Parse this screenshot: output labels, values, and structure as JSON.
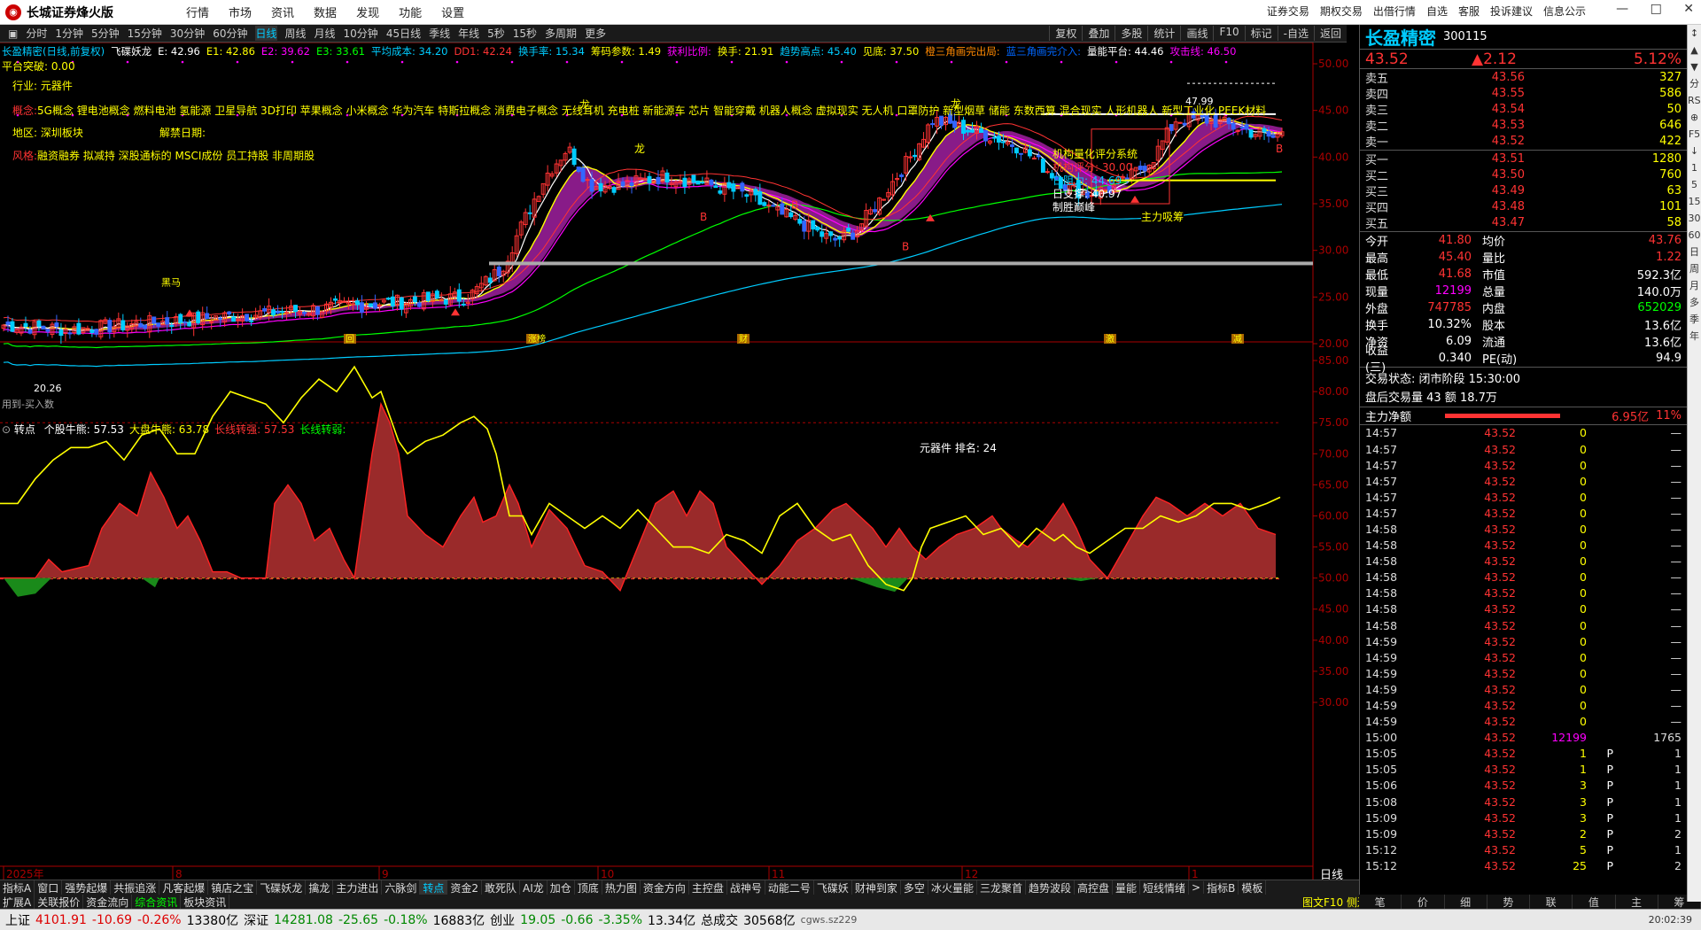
{
  "app": {
    "title": "长城证券烽火版",
    "menu": [
      "行情",
      "市场",
      "资讯",
      "数据",
      "发现",
      "功能",
      "设置"
    ],
    "right_menu": [
      "证券交易",
      "期权交易",
      "出借行情",
      "自选",
      "客服",
      "投诉建议",
      "信息公示"
    ],
    "win_icons": [
      "minimize-icon",
      "maximize-icon",
      "close-icon"
    ]
  },
  "periods": [
    "分时",
    "1分钟",
    "5分钟",
    "15分钟",
    "30分钟",
    "60分钟",
    "日线",
    "周线",
    "月线",
    "10分钟",
    "45日线",
    "季线",
    "年线",
    "5秒",
    "15秒",
    "多周期",
    "更多"
  ],
  "active_period": "日线",
  "toolbar_right": [
    "复权",
    "叠加",
    "多股",
    "统计",
    "画线",
    "F10",
    "标记",
    "-自选",
    "返回"
  ],
  "main_panel": {
    "header_items": [
      {
        "t": "长盈精密(日线,前复权)",
        "c": "#0cf"
      },
      {
        "t": "飞碟妖龙",
        "c": "#fff"
      },
      {
        "t": "E: 42.96",
        "c": "#fff"
      },
      {
        "t": "E1: 42.86",
        "c": "#ff0"
      },
      {
        "t": "E2: 39.62",
        "c": "#f0f"
      },
      {
        "t": "E3: 33.61",
        "c": "#0f0"
      },
      {
        "t": "平均成本: 34.20",
        "c": "#0cf"
      },
      {
        "t": "DD1: 42.24",
        "c": "#f33"
      },
      {
        "t": "换手率: 15.34",
        "c": "#0cf"
      },
      {
        "t": "筹码参数: 1.49",
        "c": "#ff0"
      },
      {
        "t": "获利比例:",
        "c": "#f0f"
      },
      {
        "t": "换手: 21.91",
        "c": "#ff0"
      },
      {
        "t": "趋势高点: 45.40",
        "c": "#0cf"
      },
      {
        "t": "见底: 37.50",
        "c": "#ff0"
      },
      {
        "t": "橙三角画完出局:",
        "c": "#f80"
      },
      {
        "t": "蓝三角画完介入:",
        "c": "#06f"
      },
      {
        "t": "量能平台: 44.46",
        "c": "#fff"
      },
      {
        "t": "攻击线: 46.50",
        "c": "#f0f"
      }
    ],
    "platform": "平台突破: 0.00",
    "industry": "行业: 元器件",
    "concept_label": "概念:",
    "concept": "5G概念 锂电池概念 燃料电池 氢能源 卫星导航 3D打印 苹果概念 小米概念 华为汽车 特斯拉概念 消费电子概念 无线耳机 充电桩 新能源车 芯片 智能穿戴 机器人概念 虚拟现实 无人机 口罩防护 新型烟草 储能 东数西算 混合现实 人形机器人 新型工业化 PEEK材料",
    "region": "地区: 深圳板块",
    "unlock": "解禁日期:",
    "style_label": "风格:",
    "style": "融资融券 拟减持 深股通标的 MSCI成份 员工持股 非周期股",
    "annotations": {
      "ratings": "机构量化评分系统",
      "inst_score": "机构评分: 30.00",
      "resistance": "日阻力: 44.69",
      "support": "日支撑: 40.97",
      "top": "制胜巅峰",
      "main_absorb": "主力吸筹",
      "high_label": "47.99",
      "low_label": "20.26",
      "left_note": "用到-买入数",
      "long": "龙",
      "buy": "B",
      "butterfly": "黑马",
      "axis_labels": [
        "涨榜",
        "财",
        "激",
        "减",
        "回"
      ]
    }
  },
  "sub_panel": {
    "title": "转点",
    "items": [
      {
        "t": "个股牛熊: 57.53",
        "c": "#fff"
      },
      {
        "t": "大盘牛熊: 63.78",
        "c": "#ff0"
      },
      {
        "t": "长线转强: 57.53",
        "c": "#f33"
      },
      {
        "t": "长线转弱:",
        "c": "#0f0"
      }
    ],
    "center_label": "元器件 排名: 24"
  },
  "x_labels": [
    "2025年",
    "8",
    "9",
    "10",
    "11",
    "12",
    "1"
  ],
  "period_label": "日线",
  "indicator_tabs": [
    "指标A",
    "窗口",
    "强势起爆",
    "共振追涨",
    "凡客起爆",
    "镇店之宝",
    "飞碟妖龙",
    "擒龙",
    "主力进出",
    "六脉剑",
    "转点",
    "资金2",
    "敢死队",
    "AI龙",
    "加仓",
    "顶底",
    "热力图",
    "资金方向",
    "主控盘",
    "战神号",
    "动能二号",
    "飞碟妖",
    "财神到家",
    "多空",
    "冰火量能",
    "三龙聚首",
    "趋势波段",
    "高控盘",
    "量能",
    "短线情绪",
    ">",
    "指标B",
    "模板"
  ],
  "active_indicator": "转点",
  "lower_tabs": [
    "扩展A",
    "关联报价",
    "资金流向",
    "综合资讯",
    "板块资讯"
  ],
  "active_lower_tab": "综合资讯",
  "right_tabs": [
    "笔",
    "价",
    "细",
    "势",
    "联",
    "值",
    "主",
    "筹"
  ],
  "quote": {
    "name": "长盈精密",
    "code": "300115",
    "price": "43.52",
    "change": "▲2.12",
    "pct": "5.12%",
    "asks": [
      {
        "l": "卖五",
        "p": "43.56",
        "v": "327"
      },
      {
        "l": "卖四",
        "p": "43.55",
        "v": "586"
      },
      {
        "l": "卖三",
        "p": "43.54",
        "v": "50"
      },
      {
        "l": "卖二",
        "p": "43.53",
        "v": "646"
      },
      {
        "l": "卖一",
        "p": "43.52",
        "v": "422"
      }
    ],
    "bids": [
      {
        "l": "买一",
        "p": "43.51",
        "v": "1280"
      },
      {
        "l": "买二",
        "p": "43.50",
        "v": "760"
      },
      {
        "l": "买三",
        "p": "43.49",
        "v": "63"
      },
      {
        "l": "买四",
        "p": "43.48",
        "v": "101"
      },
      {
        "l": "买五",
        "p": "43.47",
        "v": "58"
      }
    ],
    "stats": [
      {
        "l1": "今开",
        "v1": "41.80",
        "c1": "#f33",
        "l2": "均价",
        "v2": "43.76",
        "c2": "#f33"
      },
      {
        "l1": "最高",
        "v1": "45.40",
        "c1": "#f33",
        "l2": "量比",
        "v2": "1.22",
        "c2": "#f33"
      },
      {
        "l1": "最低",
        "v1": "41.68",
        "c1": "#f33",
        "l2": "市值",
        "v2": "592.3亿",
        "c2": "#fff"
      },
      {
        "l1": "现量",
        "v1": "12199",
        "c1": "#f0f",
        "l2": "总量",
        "v2": "140.0万",
        "c2": "#fff"
      },
      {
        "l1": "外盘",
        "v1": "747785",
        "c1": "#f33",
        "l2": "内盘",
        "v2": "652029",
        "c2": "#0f0"
      },
      {
        "l1": "换手",
        "v1": "10.32%",
        "c1": "#fff",
        "l2": "股本",
        "v2": "13.6亿",
        "c2": "#fff"
      },
      {
        "l1": "净资",
        "v1": "6.09",
        "c1": "#fff",
        "l2": "流通",
        "v2": "13.6亿",
        "c2": "#fff"
      },
      {
        "l1": "收益(三)",
        "v1": "0.340",
        "c1": "#fff",
        "l2": "PE(动)",
        "v2": "94.9",
        "c2": "#fff"
      }
    ],
    "trade_state": "交易状态: 闭市阶段 15:30:00",
    "after_hours": "盘后交易量 43 额 18.7万",
    "main_flow_label": "主力净额",
    "main_flow_value": "6.95亿",
    "main_flow_pct": "11%",
    "ticks": [
      {
        "t": "14:57",
        "p": "43.52",
        "v": "0",
        "f": "",
        "n": "—"
      },
      {
        "t": "14:57",
        "p": "43.52",
        "v": "0",
        "f": "",
        "n": "—"
      },
      {
        "t": "14:57",
        "p": "43.52",
        "v": "0",
        "f": "",
        "n": "—"
      },
      {
        "t": "14:57",
        "p": "43.52",
        "v": "0",
        "f": "",
        "n": "—"
      },
      {
        "t": "14:57",
        "p": "43.52",
        "v": "0",
        "f": "",
        "n": "—"
      },
      {
        "t": "14:57",
        "p": "43.52",
        "v": "0",
        "f": "",
        "n": "—"
      },
      {
        "t": "14:58",
        "p": "43.52",
        "v": "0",
        "f": "",
        "n": "—"
      },
      {
        "t": "14:58",
        "p": "43.52",
        "v": "0",
        "f": "",
        "n": "—"
      },
      {
        "t": "14:58",
        "p": "43.52",
        "v": "0",
        "f": "",
        "n": "—"
      },
      {
        "t": "14:58",
        "p": "43.52",
        "v": "0",
        "f": "",
        "n": "—"
      },
      {
        "t": "14:58",
        "p": "43.52",
        "v": "0",
        "f": "",
        "n": "—"
      },
      {
        "t": "14:58",
        "p": "43.52",
        "v": "0",
        "f": "",
        "n": "—"
      },
      {
        "t": "14:58",
        "p": "43.52",
        "v": "0",
        "f": "",
        "n": "—"
      },
      {
        "t": "14:59",
        "p": "43.52",
        "v": "0",
        "f": "",
        "n": "—"
      },
      {
        "t": "14:59",
        "p": "43.52",
        "v": "0",
        "f": "",
        "n": "—"
      },
      {
        "t": "14:59",
        "p": "43.52",
        "v": "0",
        "f": "",
        "n": "—"
      },
      {
        "t": "14:59",
        "p": "43.52",
        "v": "0",
        "f": "",
        "n": "—"
      },
      {
        "t": "14:59",
        "p": "43.52",
        "v": "0",
        "f": "",
        "n": "—"
      },
      {
        "t": "14:59",
        "p": "43.52",
        "v": "0",
        "f": "",
        "n": "—"
      },
      {
        "t": "15:00",
        "p": "43.52",
        "v": "12199",
        "f": "",
        "n": "1765"
      },
      {
        "t": "15:05",
        "p": "43.52",
        "v": "1",
        "f": "P",
        "n": "1"
      },
      {
        "t": "15:05",
        "p": "43.52",
        "v": "1",
        "f": "P",
        "n": "1"
      },
      {
        "t": "15:06",
        "p": "43.52",
        "v": "3",
        "f": "P",
        "n": "1"
      },
      {
        "t": "15:08",
        "p": "43.52",
        "v": "3",
        "f": "P",
        "n": "1"
      },
      {
        "t": "15:09",
        "p": "43.52",
        "v": "3",
        "f": "P",
        "n": "1"
      },
      {
        "t": "15:09",
        "p": "43.52",
        "v": "2",
        "f": "P",
        "n": "2"
      },
      {
        "t": "15:12",
        "p": "43.52",
        "v": "5",
        "f": "P",
        "n": "1"
      },
      {
        "t": "15:12",
        "p": "43.52",
        "v": "25",
        "f": "P",
        "n": "2"
      }
    ]
  },
  "sidetools": [
    "↕",
    "▲",
    "▼",
    "分",
    "RSI",
    "⊕",
    "F5",
    "↓",
    "1",
    "5",
    "15",
    "30",
    "60",
    "日",
    "周",
    "月",
    "多",
    "季",
    "年"
  ],
  "status": {
    "sh_label": "上证",
    "sh_val": "4101.91",
    "sh_chg": "-10.69",
    "sh_pct": "-0.26%",
    "sh_amt": "13380亿",
    "sz_label": "深证",
    "sz_val": "14281.08",
    "sz_chg": "-25.65",
    "sz_pct": "-0.18%",
    "sz_amt": "16883亿",
    "cy_label": "创业",
    "cy_val": "19.05",
    "cy_chg": "-0.66",
    "cy_pct": "-3.35%",
    "cy_amt": "13.34亿",
    "total_label": "总成交",
    "total_val": "30568亿",
    "server": "cgws.sz229",
    "time": "20:02:39"
  },
  "chart_data": {
    "type": "candlestick",
    "price_axis": [
      50,
      45,
      40,
      35,
      30,
      25,
      20
    ],
    "sub_axis": [
      85,
      80,
      75,
      70,
      65,
      60,
      55,
      50,
      45,
      40,
      35,
      30
    ],
    "price_series_note": "daily candles",
    "ma_colors": {
      "E": "#fff",
      "E1": "#ff0",
      "E2": "#f0f",
      "E3": "#0f0",
      "cost": "#0cf",
      "dd1": "#f33"
    },
    "sub_series": [
      {
        "name": "个股牛熊",
        "color": "#ff0"
      },
      {
        "name": "长线转强",
        "color": "#f33"
      },
      {
        "name": "长线转弱",
        "color": "#0f0"
      }
    ]
  }
}
